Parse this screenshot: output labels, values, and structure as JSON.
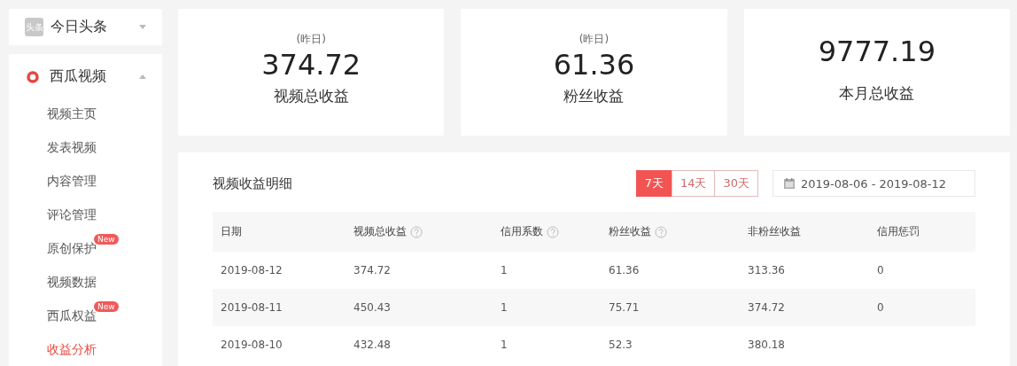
{
  "sidebar": {
    "top": {
      "logo": "头条",
      "label": "今日头条",
      "expanded": false
    },
    "group": {
      "label": "西瓜视频",
      "expanded": true,
      "items": [
        {
          "label": "视频主页",
          "selected": false
        },
        {
          "label": "发表视频",
          "selected": false
        },
        {
          "label": "内容管理",
          "selected": false
        },
        {
          "label": "评论管理",
          "selected": false
        },
        {
          "label": "原创保护",
          "selected": false,
          "badge": "New"
        },
        {
          "label": "视频数据",
          "selected": false
        },
        {
          "label": "西瓜权益",
          "selected": false,
          "badge": "New"
        },
        {
          "label": "收益分析",
          "selected": true
        }
      ]
    }
  },
  "stats": [
    {
      "note": "(昨日)",
      "value": "374.72",
      "label": "视频总收益"
    },
    {
      "note": "(昨日)",
      "value": "61.36",
      "label": "粉丝收益"
    },
    {
      "value": "9777.19",
      "label": "本月总收益"
    }
  ],
  "detail": {
    "title": "视频收益明细",
    "ranges": [
      {
        "label": "7天",
        "selected": true
      },
      {
        "label": "14天",
        "selected": false
      },
      {
        "label": "30天",
        "selected": false
      }
    ],
    "date_range": "2019-08-06 - 2019-08-12",
    "columns": [
      {
        "label": "日期",
        "help": false
      },
      {
        "label": "视频总收益",
        "help": true
      },
      {
        "label": "信用系数",
        "help": true
      },
      {
        "label": "粉丝收益",
        "help": true
      },
      {
        "label": "非粉丝收益",
        "help": false
      },
      {
        "label": "信用惩罚",
        "help": false
      }
    ],
    "rows": [
      [
        "2019-08-12",
        "374.72",
        "1",
        "61.36",
        "313.36",
        "0"
      ],
      [
        "2019-08-11",
        "450.43",
        "1",
        "75.71",
        "374.72",
        "0"
      ],
      [
        "2019-08-10",
        "432.48",
        "1",
        "52.3",
        "380.18"
      ]
    ]
  }
}
